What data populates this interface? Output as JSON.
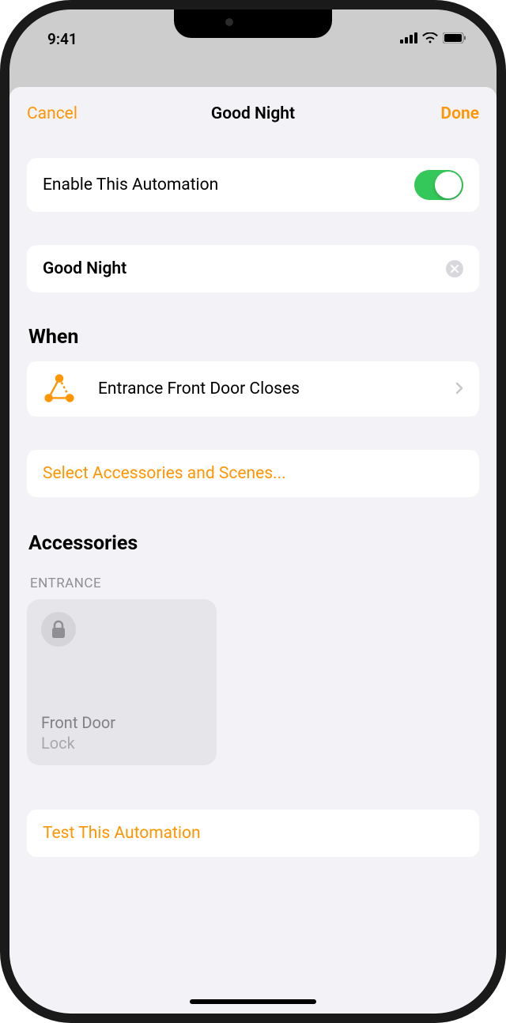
{
  "status": {
    "time": "9:41"
  },
  "nav": {
    "cancel": "Cancel",
    "title": "Good Night",
    "done": "Done"
  },
  "enable": {
    "label": "Enable This Automation",
    "on": true
  },
  "name": {
    "value": "Good Night"
  },
  "when": {
    "header": "When",
    "trigger": "Entrance Front Door Closes"
  },
  "select": {
    "label": "Select Accessories and Scenes..."
  },
  "accessories": {
    "header": "Accessories",
    "group": "ENTRANCE",
    "tile": {
      "name": "Front Door",
      "status": "Lock"
    }
  },
  "test": {
    "label": "Test This Automation"
  }
}
